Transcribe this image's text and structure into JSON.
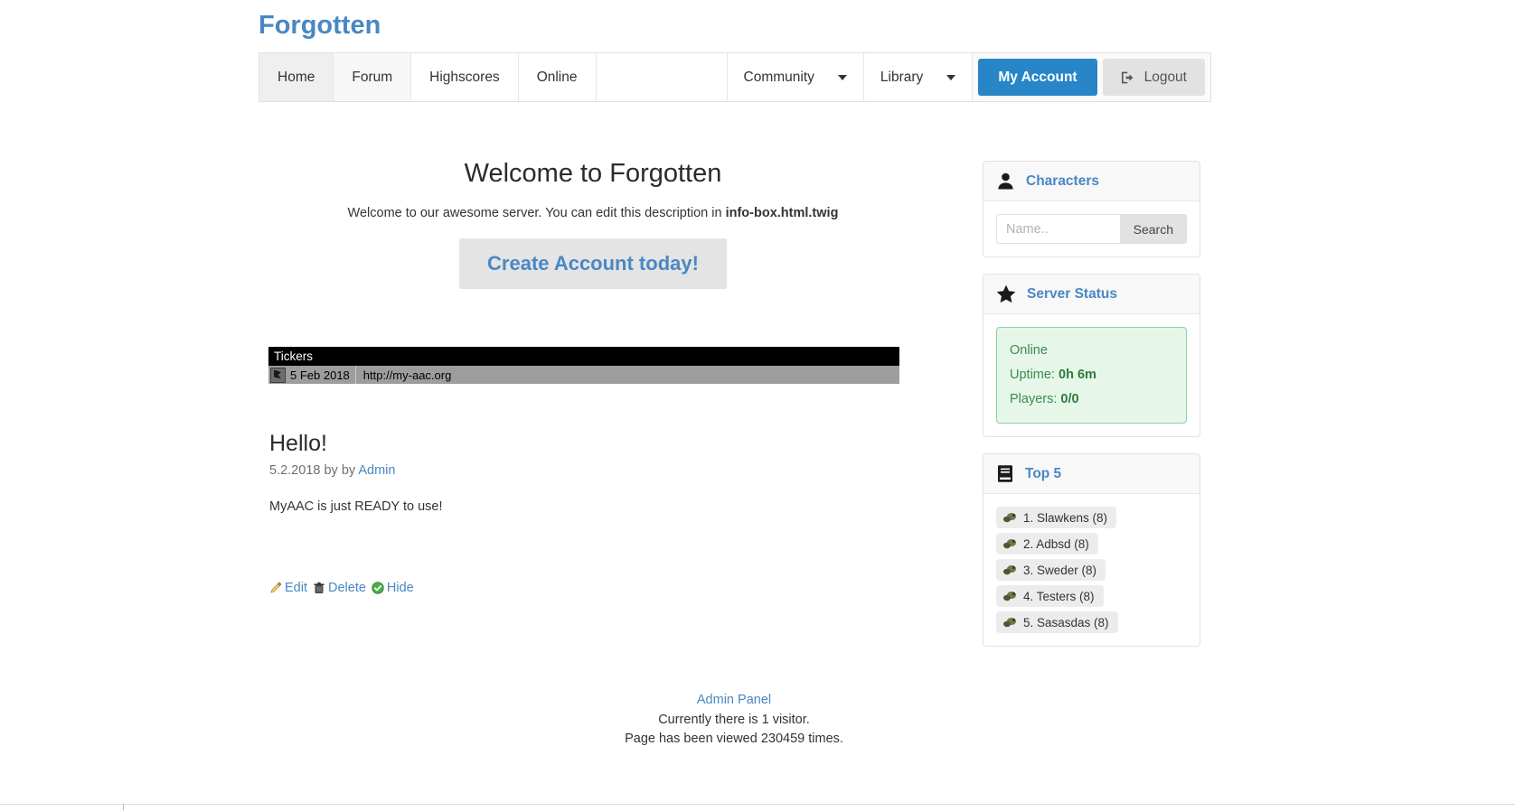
{
  "site": {
    "logo": "Forgotten"
  },
  "nav": {
    "items": [
      {
        "label": "Home"
      },
      {
        "label": "Forum"
      },
      {
        "label": "Highscores"
      },
      {
        "label": "Online"
      }
    ],
    "dropdowns": [
      {
        "label": "Community",
        "icon": "chevron-down-icon"
      },
      {
        "label": "Library",
        "icon": "chevron-down-icon"
      }
    ],
    "account_button": "My Account",
    "logout_button": "Logout",
    "logout_icon": "sign-out-icon"
  },
  "main": {
    "welcome_title": "Welcome to Forgotten",
    "welcome_desc_prefix": "Welcome to our awesome server. You can edit this description in ",
    "welcome_desc_file": "info-box.html.twig",
    "create_account": "Create Account today!"
  },
  "tickers": {
    "header": "Tickers",
    "rows": [
      {
        "icon": "ticker-flag-icon",
        "date": "5 Feb 2018",
        "link": "http://my-aac.org"
      }
    ]
  },
  "news": {
    "title": "Hello!",
    "meta_date": "5.2.2018 by by ",
    "meta_author": "Admin",
    "body": "MyAAC is just READY to use!",
    "actions": [
      {
        "label": "Edit",
        "icon": "pencil-icon"
      },
      {
        "label": "Delete",
        "icon": "trash-icon"
      },
      {
        "label": "Hide",
        "icon": "check-circle-icon"
      }
    ]
  },
  "sidebar": {
    "characters": {
      "title": "Characters",
      "icon": "user-icon",
      "input_placeholder": "Name..",
      "input_value": "",
      "search_button": "Search"
    },
    "server_status": {
      "title": "Server Status",
      "icon": "star-icon",
      "state": "Online",
      "uptime_label": "Uptime: ",
      "uptime_value": "0h 6m",
      "players_label": "Players: ",
      "players_value": "0/0"
    },
    "top5": {
      "title": "Top 5",
      "icon": "book-icon",
      "items": [
        {
          "label": "1. Slawkens (8)",
          "icon": "outfit-icon"
        },
        {
          "label": "2. Adbsd (8)",
          "icon": "outfit-icon"
        },
        {
          "label": "3. Sweder (8)",
          "icon": "outfit-icon"
        },
        {
          "label": "4. Testers (8)",
          "icon": "outfit-icon"
        },
        {
          "label": "5. Sasasdas (8)",
          "icon": "outfit-icon"
        }
      ]
    }
  },
  "footer": {
    "admin_panel": "Admin Panel",
    "visitors": "Currently there is 1 visitor.",
    "views": "Page has been viewed 230459 times."
  },
  "colors": {
    "accent_blue": "#4a87c4",
    "button_blue": "#2785c8",
    "status_green": "#3c8a4e",
    "status_bg": "#e6f6e9"
  }
}
